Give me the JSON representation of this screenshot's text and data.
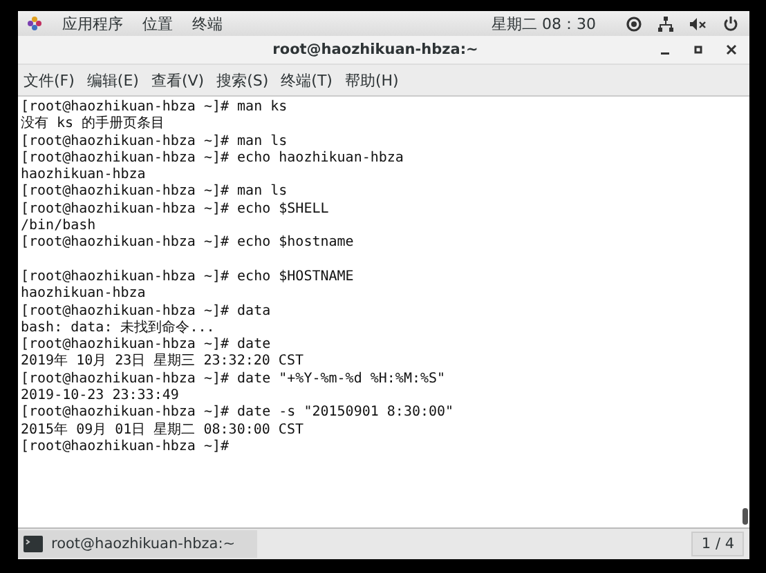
{
  "top_bar": {
    "menus": [
      "应用程序",
      "位置",
      "终端"
    ],
    "clock": "星期二 08：30"
  },
  "window": {
    "title": "root@haozhikuan-hbza:~"
  },
  "menu_bar": [
    "文件(F)",
    "编辑(E)",
    "查看(V)",
    "搜索(S)",
    "终端(T)",
    "帮助(H)"
  ],
  "terminal": {
    "lines": [
      {
        "kind": "line",
        "text": "[root@haozhikuan-hbza ~]# man ks"
      },
      {
        "kind": "line",
        "text": "没有 ks 的手册页条目"
      },
      {
        "kind": "line",
        "text": "[root@haozhikuan-hbza ~]# man ls"
      },
      {
        "kind": "line",
        "text": "[root@haozhikuan-hbza ~]# echo haozhikuan-hbza"
      },
      {
        "kind": "line",
        "text": "haozhikuan-hbza"
      },
      {
        "kind": "line",
        "text": "[root@haozhikuan-hbza ~]# man ls"
      },
      {
        "kind": "line",
        "text": "[root@haozhikuan-hbza ~]# echo $SHELL"
      },
      {
        "kind": "line",
        "text": "/bin/bash"
      },
      {
        "kind": "line",
        "text": "[root@haozhikuan-hbza ~]# echo $hostname"
      },
      {
        "kind": "blank"
      },
      {
        "kind": "line",
        "text": "[root@haozhikuan-hbza ~]# echo $HOSTNAME"
      },
      {
        "kind": "line",
        "text": "haozhikuan-hbza"
      },
      {
        "kind": "line",
        "text": "[root@haozhikuan-hbza ~]# data"
      },
      {
        "kind": "line",
        "text": "bash: data: 未找到命令..."
      },
      {
        "kind": "line",
        "text": "[root@haozhikuan-hbza ~]# date"
      },
      {
        "kind": "line",
        "text": "2019年 10月 23日 星期三 23:32:20 CST"
      },
      {
        "kind": "line",
        "text": "[root@haozhikuan-hbza ~]# date \"+%Y-%m-%d %H:%M:%S\""
      },
      {
        "kind": "line",
        "text": "2019-10-23 23:33:49"
      },
      {
        "kind": "line",
        "text": "[root@haozhikuan-hbza ~]# date -s \"20150901 8:30:00\""
      },
      {
        "kind": "line",
        "text": "2015年 09月 01日 星期二 08:30:00 CST"
      },
      {
        "kind": "line",
        "text": "[root@haozhikuan-hbza ~]#"
      }
    ]
  },
  "taskbar": {
    "task": "root@haozhikuan-hbza:~",
    "workspace": "1 / 4"
  }
}
